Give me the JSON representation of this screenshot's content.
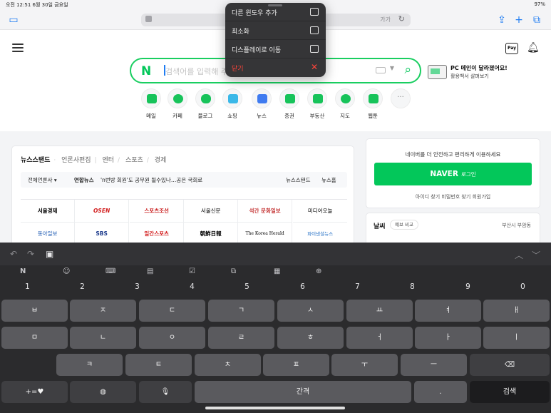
{
  "status": {
    "left": "오전 12:51  6월 30일 금요일",
    "right": "97%"
  },
  "browser": {
    "url_lang": "가가"
  },
  "menu": {
    "items": [
      {
        "label": "다른 윈도우 추가"
      },
      {
        "label": "최소화"
      },
      {
        "label": "디스플레이로 이동"
      },
      {
        "label": "닫기"
      }
    ]
  },
  "page": {
    "search_placeholder": "검색어를 입력해 주세요.",
    "promo_title": "PC 메인이 달라졌어요!",
    "promo_sub": "활용백서 살펴보기",
    "shortcuts": [
      "메일",
      "카페",
      "블로그",
      "쇼핑",
      "뉴스",
      "증권",
      "부동산",
      "지도",
      "웹툰"
    ],
    "pay_label": "Pay",
    "news": {
      "tabs": {
        "active": "뉴스스탠드",
        "t2": "언론사편집",
        "t3": "엔터",
        "t4": "스포츠",
        "t5": "경제"
      },
      "strip": {
        "press": "전체언론사 ▾",
        "headline_src": "연합뉴스",
        "headline": "'n번방 회원'도 공무원 될수있나…공은 국회로",
        "r1": "뉴스스탠드",
        "r2": "뉴스홈"
      },
      "press": [
        "서울경제",
        "OSEN",
        "스포츠조선",
        "서울신문",
        "석간 문화일보",
        "미디어오늘",
        "동아일보",
        "SBS",
        "일간스포츠",
        "朝鮮日報",
        "The Korea Herald",
        "파이낸셜뉴스"
      ]
    },
    "login": {
      "msg": "네이버를 더 안전하고 편리하게 이용하세요",
      "brand": "NAVER",
      "label": "로그인",
      "links": "아이디 찾기    비밀번호 찾기    회원가입"
    },
    "weather": {
      "title": "날씨",
      "pill": "예보 비교",
      "loc": "부산시 부암동"
    }
  },
  "keyboard": {
    "tools": [
      "N",
      "☺",
      "⌨",
      "▤",
      "☑",
      "⧉",
      "▦",
      "⊕"
    ],
    "numbers": [
      "1",
      "2",
      "3",
      "4",
      "5",
      "6",
      "7",
      "8",
      "9",
      "0"
    ],
    "row_a": [
      "ㅂ",
      "ㅈ",
      "ㄷ",
      "ㄱ",
      "ㅅ",
      "ㅛ",
      "ㅕ",
      "ㅑ",
      "ㅐ",
      "ㅔ"
    ],
    "row_b": [
      "ㅁ",
      "ㄴ",
      "ㅇ",
      "ㄹ",
      "ㅎ",
      "ㅗ",
      "ㅓ",
      "ㅏ",
      "ㅣ"
    ],
    "row_c": [
      "ㅋ",
      "ㅌ",
      "ㅊ",
      "ㅍ",
      "ㅠ",
      "ㅜ",
      "ㅡ"
    ],
    "sym": "+=♥",
    "space": "간격",
    "period": ".",
    "search": "검색"
  }
}
